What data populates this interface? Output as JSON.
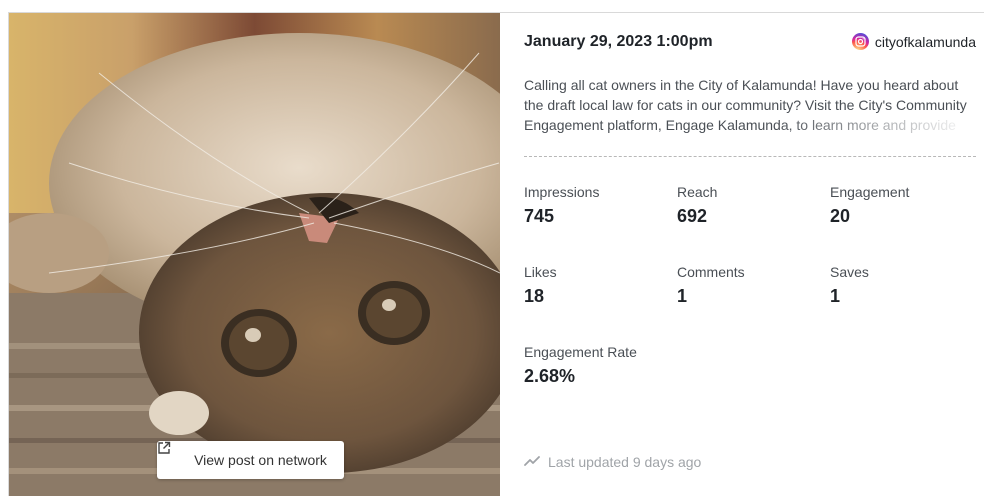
{
  "post": {
    "button_label": "View post on network",
    "date": "January 29, 2023 1:00pm",
    "handle": "cityofkalamunda",
    "caption": "Calling all cat owners in the City of Kalamunda! Have you heard about the draft local law for cats in our community? Visit the City's Community Engagement platform, Engage Kalamunda, to learn more and provide"
  },
  "metrics": {
    "impressions": {
      "label": "Impressions",
      "value": "745"
    },
    "reach": {
      "label": "Reach",
      "value": "692"
    },
    "engagement": {
      "label": "Engagement",
      "value": "20"
    },
    "likes": {
      "label": "Likes",
      "value": "18"
    },
    "comments": {
      "label": "Comments",
      "value": "1"
    },
    "saves": {
      "label": "Saves",
      "value": "1"
    },
    "engagement_rate": {
      "label": "Engagement Rate",
      "value": "2.68%"
    }
  },
  "footer": {
    "updated": "Last updated 9 days ago"
  },
  "icons": {
    "network": "instagram-icon",
    "external": "external-link-icon",
    "trend": "trend-line-icon"
  },
  "colors": {
    "text": "#1f2328",
    "muted": "#4a4f55",
    "faint": "#a0a4a8"
  }
}
